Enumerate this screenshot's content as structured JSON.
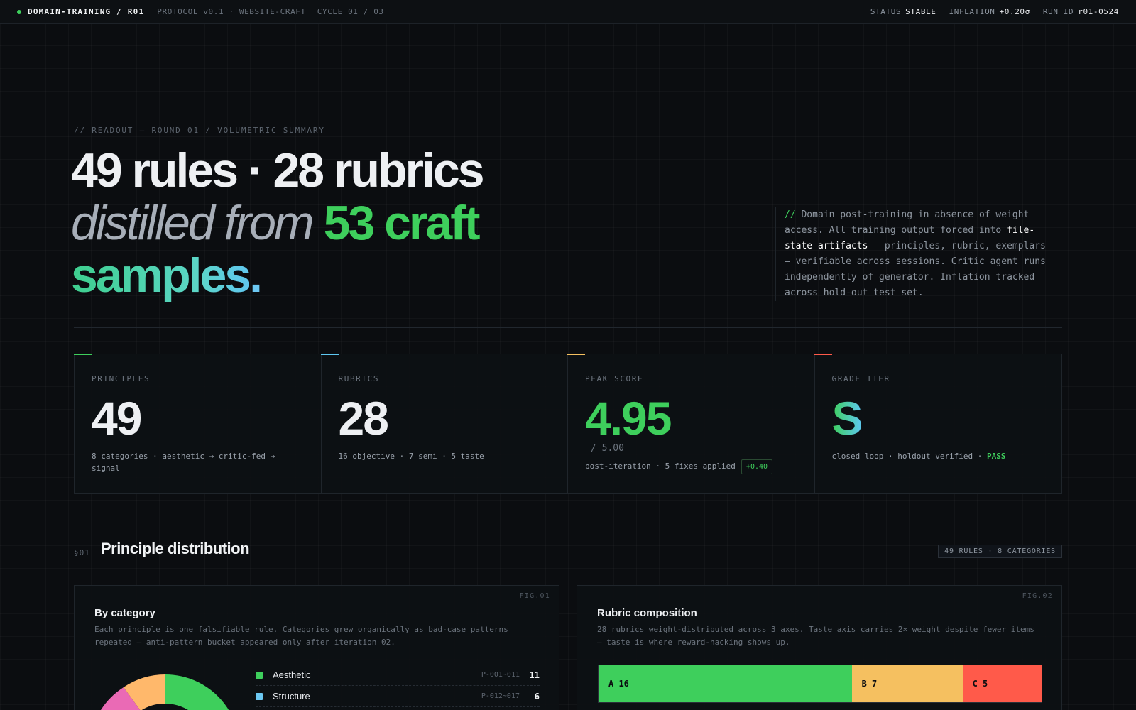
{
  "topbar": {
    "brand": "DOMAIN-TRAINING / R01",
    "protocol": "PROTOCOL_v0.1 · WEBSITE-CRAFT",
    "cycle": "CYCLE 01 / 03",
    "status_key": "STATUS",
    "status_val": "STABLE",
    "inflation_key": "INFLATION",
    "inflation_val": "+0.20σ",
    "run_key": "RUN_ID",
    "run_val": "r01-0524"
  },
  "hero": {
    "eyebrow": "// READOUT — ROUND 01 / VOLUMETRIC SUMMARY",
    "line1": "49 rules · 28 rubrics",
    "line2a": "distilled from",
    "line2b": "53 craft",
    "line3": "samples",
    "period": "."
  },
  "aside": {
    "slashes": "//",
    "text1": "Domain post-training in absence of weight access. All training output forced into",
    "highlight": "file-state artifacts",
    "text2": "— principles, rubric, exemplars — verifiable across sessions. Critic agent runs independently of generator. Inflation tracked across hold-out test set."
  },
  "cards": [
    {
      "label": "PRINCIPLES",
      "value": "49",
      "sub": "8 categories · aesthetic → critic-fed → signal",
      "accent": "#3ecf5c"
    },
    {
      "label": "RUBRICS",
      "value": "28",
      "sub": "16 objective · 7 semi · 5 taste",
      "accent": "#5ec8f2"
    },
    {
      "label": "PEAK SCORE",
      "value": "4.95",
      "outof": "/ 5.00",
      "sub": "post-iteration · 5 fixes applied",
      "chip": "+0.40",
      "accent": "#f5c060"
    },
    {
      "label": "GRADE TIER",
      "value": "S",
      "sub": "closed loop · holdout verified ·",
      "pass": "PASS",
      "accent": "#ff5a4a"
    }
  ],
  "section": {
    "num": "§01",
    "title": "Principle distribution",
    "tag": "49 RULES · 8 CATEGORIES"
  },
  "fig1": {
    "fig": "FIG.01",
    "title": "By category",
    "desc": "Each principle is one falsifiable rule. Categories grew organically as bad-case patterns repeated — anti-pattern bucket appeared only after iteration 02.",
    "legend": [
      {
        "name": "Aesthetic",
        "range": "P-001~011",
        "count": "11",
        "color": "#3ecf5c"
      },
      {
        "name": "Structure",
        "range": "P-012~017",
        "count": "6",
        "color": "#6cc8f2"
      }
    ]
  },
  "fig2": {
    "fig": "FIG.02",
    "title": "Rubric composition",
    "desc": "28 rubrics weight-distributed across 3 axes. Taste axis carries 2× weight despite fewer items — taste is where reward-hacking shows up.",
    "segments": [
      {
        "label": "A 16",
        "value": 16,
        "color": "#3ecf5c"
      },
      {
        "label": "B 7",
        "value": 7,
        "color": "#f5c060"
      },
      {
        "label": "C 5",
        "value": 5,
        "color": "#ff5a4a"
      }
    ]
  },
  "colors": {
    "accent_green": "#3ecf5c",
    "accent_cyan": "#6cc8f2",
    "accent_amber": "#f5c060",
    "accent_red": "#ff5a4a"
  }
}
